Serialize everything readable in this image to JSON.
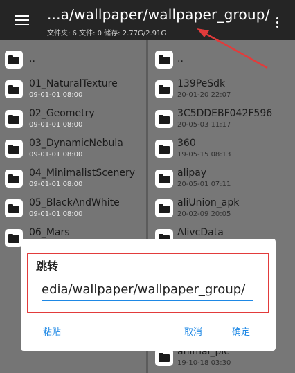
{
  "header": {
    "path_title": "...a/wallpaper/wallpaper_group/",
    "stats": "文件夹: 6  文件: 0  储存: 2.77G/2.91G"
  },
  "left_pane": {
    "items": [
      {
        "name": "..",
        "date": ""
      },
      {
        "name": "01_NaturalTexture",
        "date": "09-01-01 08:00"
      },
      {
        "name": "02_Geometry",
        "date": "09-01-01 08:00"
      },
      {
        "name": "03_DynamicNebula",
        "date": "09-01-01 08:00"
      },
      {
        "name": "04_MinimalistScenery",
        "date": "09-01-01 08:00"
      },
      {
        "name": "05_BlackAndWhite",
        "date": "09-01-01 08:00"
      },
      {
        "name": "06_Mars",
        "date": ""
      }
    ]
  },
  "right_pane": {
    "items": [
      {
        "name": "..",
        "date": ""
      },
      {
        "name": "139PeSdk",
        "date": "20-01-20 22:07"
      },
      {
        "name": "3C5DDEBF042F596",
        "date": "20-05-03 11:17"
      },
      {
        "name": "360",
        "date": "19-05-15 08:13"
      },
      {
        "name": "alipay",
        "date": "20-05-01 07:11"
      },
      {
        "name": "aliUnion_apk",
        "date": "20-02-09 20:05"
      },
      {
        "name": "AlivcData",
        "date": ""
      },
      {
        "name": "animal_pic",
        "date": "19-10-18 03:30"
      }
    ]
  },
  "dialog": {
    "title": "跳转",
    "input_value": "edia/wallpaper/wallpaper_group/",
    "paste_label": "粘贴",
    "cancel_label": "取消",
    "ok_label": "确定"
  },
  "colors": {
    "accent": "#1e88e5",
    "annotation": "#e23b3b"
  }
}
